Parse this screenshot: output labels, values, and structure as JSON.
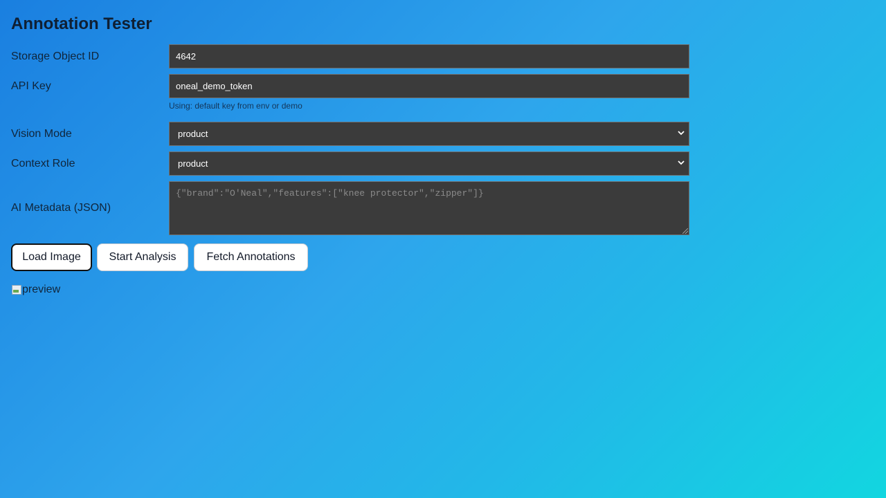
{
  "title": "Annotation Tester",
  "fields": {
    "storage_object_id": {
      "label": "Storage Object ID",
      "value": "4642"
    },
    "api_key": {
      "label": "API Key",
      "value": "oneal_demo_token",
      "hint": "Using: default key from env or demo"
    },
    "vision_mode": {
      "label": "Vision Mode",
      "value": "product"
    },
    "context_role": {
      "label": "Context Role",
      "value": "product"
    },
    "ai_metadata": {
      "label": "AI Metadata (JSON)",
      "value": "",
      "placeholder": "{\"brand\":\"O'Neal\",\"features\":[\"knee protector\",\"zipper\"]}"
    }
  },
  "buttons": {
    "load_image": "Load Image",
    "start_analysis": "Start Analysis",
    "fetch_annotations": "Fetch Annotations"
  },
  "preview": {
    "alt": "preview"
  },
  "icons": {
    "select_chevron": "chevron-down-icon",
    "broken_image": "broken-image-icon"
  }
}
